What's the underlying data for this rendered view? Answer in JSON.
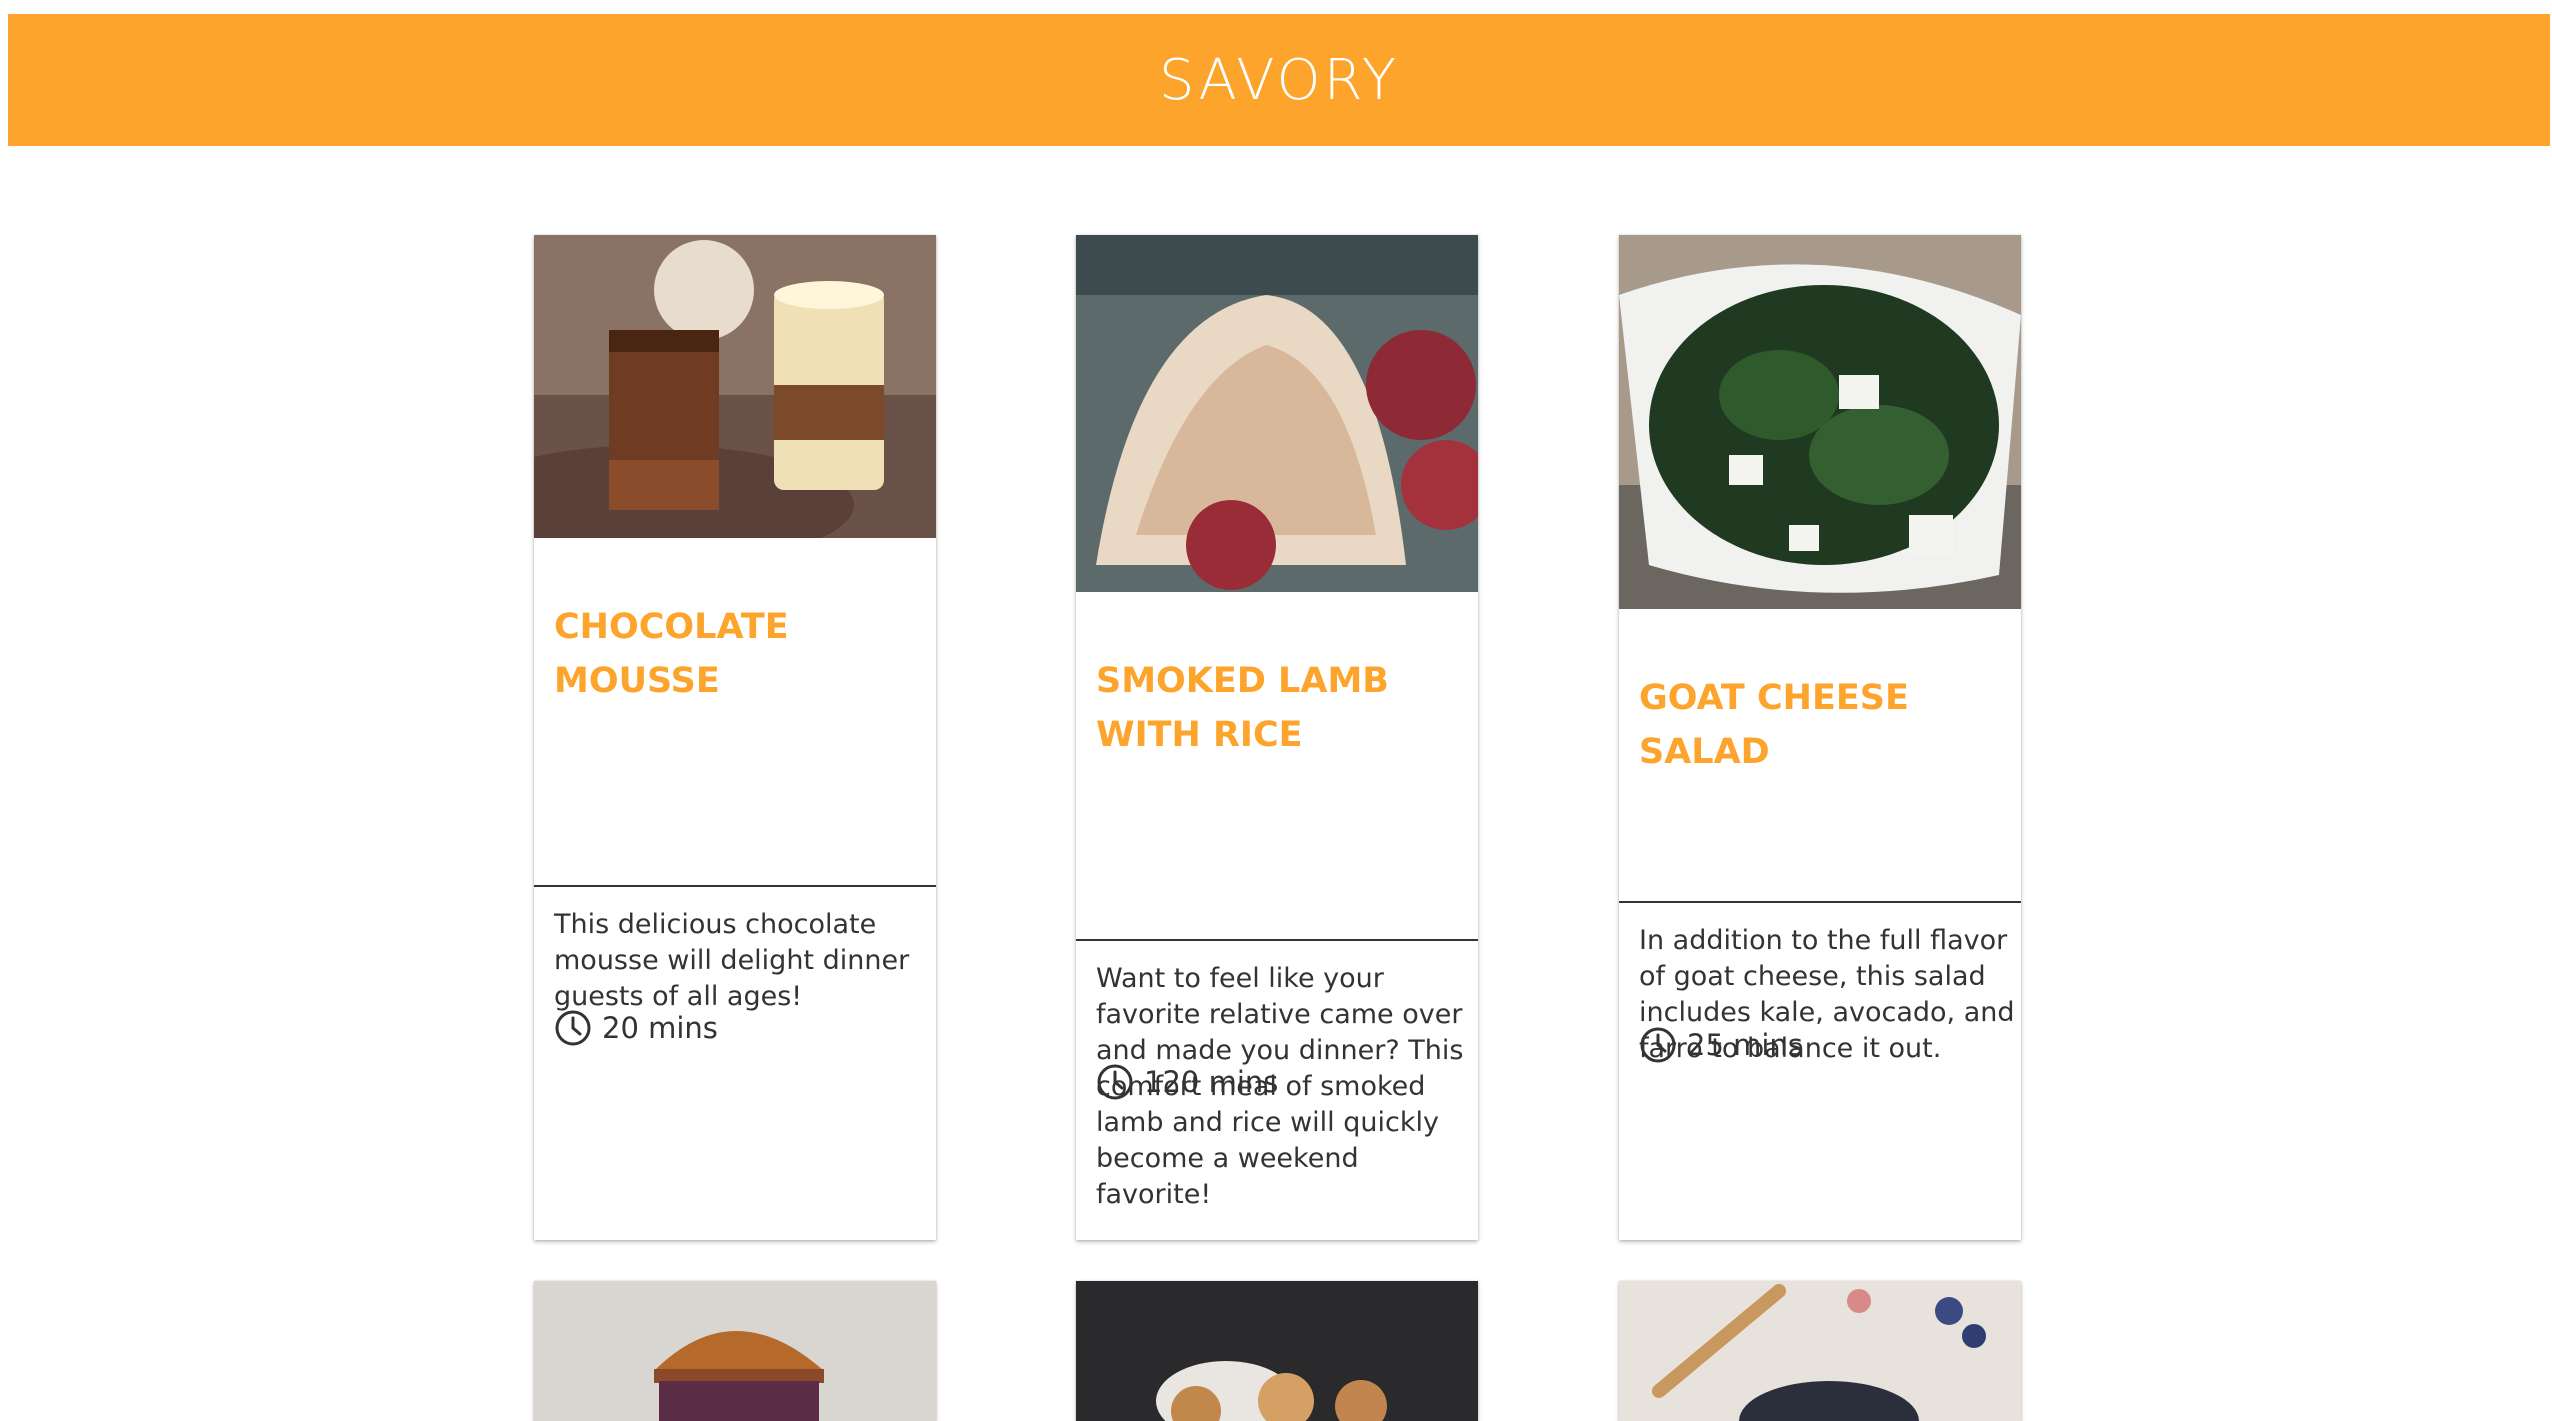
{
  "header": {
    "title": "SAVORY"
  },
  "colors": {
    "accent": "#FCA42B",
    "text": "#333333",
    "divider": "#333333"
  },
  "cards": [
    {
      "title": "CHOCOLATE MOUSSE",
      "time": "20 mins",
      "description": "This delicious chocolate mousse will delight dinner guests of all ages!",
      "image": "chocolate-mousse-photo"
    },
    {
      "title": "SMOKED LAMB WITH RICE",
      "time": "120 mins",
      "description": "Want to feel like your favorite relative came over and made you dinner? This comfort meal of smoked lamb and rice will quickly become a weekend favorite!",
      "image": "smoked-lamb-rice-photo"
    },
    {
      "title": "GOAT CHEESE SALAD",
      "time": "25 mins",
      "description": "In addition to the full flavor of goat cheese, this salad includes kale, avocado, and farro to balance it out.",
      "image": "goat-cheese-salad-photo"
    }
  ],
  "partial_cards": [
    {
      "image": "burger-photo"
    },
    {
      "image": "donuts-photo"
    },
    {
      "image": "berries-bowl-photo"
    }
  ],
  "icons": {
    "time": "clock-icon"
  }
}
